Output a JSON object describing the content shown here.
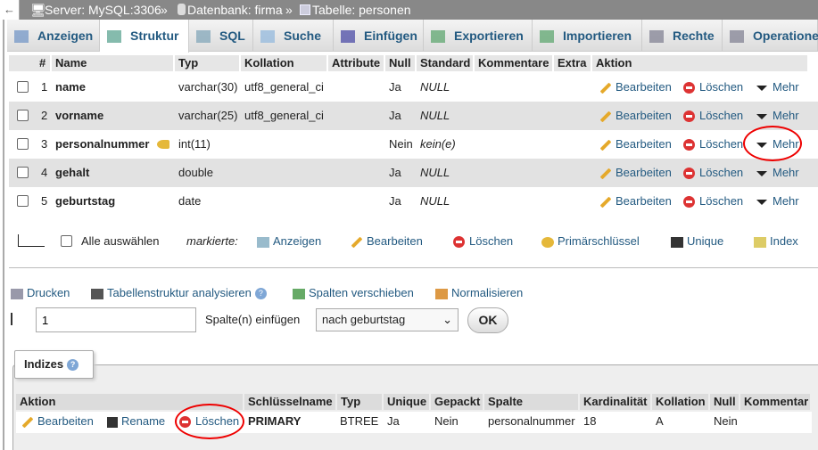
{
  "breadcrumb": {
    "back": "←",
    "server": "Server: MySQL:3306",
    "sep": "»",
    "database": "Datenbank: firma",
    "table": "Tabelle: personen"
  },
  "tabs": [
    {
      "label": "Anzeigen"
    },
    {
      "label": "Struktur",
      "active": true
    },
    {
      "label": "SQL"
    },
    {
      "label": "Suche"
    },
    {
      "label": "Einfügen"
    },
    {
      "label": "Exportieren"
    },
    {
      "label": "Importieren"
    },
    {
      "label": "Rechte"
    },
    {
      "label": "Operationen"
    }
  ],
  "columns_table": {
    "headers": [
      "#",
      "Name",
      "Typ",
      "Kollation",
      "Attribute",
      "Null",
      "Standard",
      "Kommentare",
      "Extra",
      "Aktion"
    ],
    "rows": [
      {
        "num": "1",
        "name": "name",
        "type": "varchar(30)",
        "collation": "utf8_general_ci",
        "null": "Ja",
        "default": "NULL",
        "primary": false
      },
      {
        "num": "2",
        "name": "vorname",
        "type": "varchar(25)",
        "collation": "utf8_general_ci",
        "null": "Ja",
        "default": "NULL",
        "primary": false
      },
      {
        "num": "3",
        "name": "personalnummer",
        "type": "int(11)",
        "collation": "",
        "null": "Nein",
        "default": "kein(e)",
        "primary": true
      },
      {
        "num": "4",
        "name": "gehalt",
        "type": "double",
        "collation": "",
        "null": "Ja",
        "default": "NULL",
        "primary": false
      },
      {
        "num": "5",
        "name": "geburtstag",
        "type": "date",
        "collation": "",
        "null": "Ja",
        "default": "NULL",
        "primary": false
      }
    ],
    "actions": {
      "edit": "Bearbeiten",
      "delete": "Löschen",
      "more": "Mehr"
    }
  },
  "bulk": {
    "select_all": "Alle auswählen",
    "marked": "markierte:",
    "show": "Anzeigen",
    "edit": "Bearbeiten",
    "delete": "Löschen",
    "primary": "Primärschlüssel",
    "unique": "Unique",
    "index": "Index"
  },
  "tools": {
    "print": "Drucken",
    "analyze": "Tabellenstruktur analysieren",
    "move": "Spalten verschieben",
    "normalize": "Normalisieren"
  },
  "add_column": {
    "count": "1",
    "label": "Spalte(n) einfügen",
    "position": "nach geburtstag",
    "ok": "OK"
  },
  "indexes": {
    "legend": "Indizes",
    "headers": [
      "Aktion",
      "Schlüsselname",
      "Typ",
      "Unique",
      "Gepackt",
      "Spalte",
      "Kardinalität",
      "Kollation",
      "Null",
      "Kommentar"
    ],
    "row": {
      "edit": "Bearbeiten",
      "rename": "Rename",
      "delete": "Löschen",
      "keyname": "PRIMARY",
      "type": "BTREE",
      "unique": "Ja",
      "packed": "Nein",
      "column": "personalnummer",
      "cardinality": "18",
      "collation": "A",
      "null": "Nein",
      "comment": ""
    }
  },
  "colors": {
    "link": "#235a81",
    "highlight_circle": "#e00000",
    "topbar": "#888888"
  }
}
